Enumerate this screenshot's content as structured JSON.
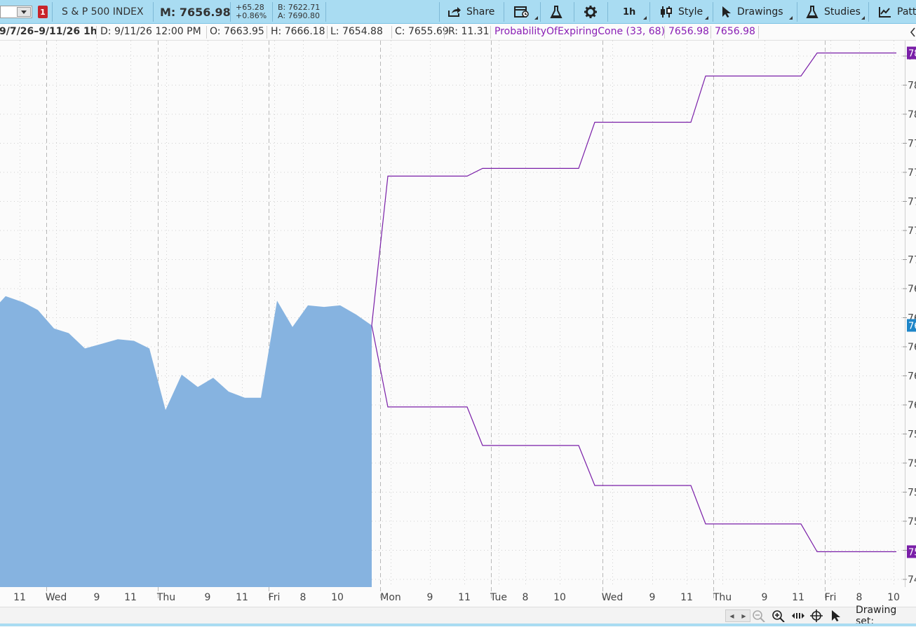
{
  "toolbar": {
    "link_number": "1",
    "symbol_name": "S & P 500 INDEX",
    "mark_price": "M: 7656.98",
    "net_change": "+65.28",
    "percent_change": "+0.86%",
    "bid": "B: 7622.71",
    "ask": "A: 7690.80",
    "share_label": "Share",
    "aggregation_label": "1h",
    "style_label": "Style",
    "drawings_label": "Drawings",
    "studies_label": "Studies",
    "patterns_label": "Patt"
  },
  "info_row": {
    "date_range": "9/7/26–9/11/26 1h",
    "date": "D: 9/11/26 12:00 PM",
    "open": "O: 7663.95",
    "high": "H: 7666.18",
    "low": "L: 7654.88",
    "close": "C: 7655.69",
    "range": "R: 11.31",
    "study_name": "ProbabilityOfExpiringCone (33, 68)",
    "study_value_1": "7656.98",
    "study_value_2": "7656.98"
  },
  "bottom_bar": {
    "drawing_set_label": "Drawing set:"
  },
  "colors": {
    "area_fill": "#86b3e0",
    "cone_line": "#7a1fa8",
    "toolbar_bg": "#a9dcf2",
    "price_tag": "#1f86c8",
    "cone_tag": "#7a1fa8"
  },
  "chart_data": {
    "type": "area",
    "title": "",
    "xlabel": "",
    "ylabel": "",
    "ylim": [
      7475,
      7830
    ],
    "grid": true,
    "x_tick_labels": [
      "11",
      "Wed",
      "9",
      "11",
      "Thu",
      "9",
      "11",
      "Fri",
      "8",
      "10",
      "Mon",
      "9",
      "11",
      "Tue",
      "8",
      "10",
      "Wed",
      "9",
      "11",
      "Thu",
      "9",
      "11",
      "Fri",
      "8",
      "10"
    ],
    "y_tick_labels": [
      "78",
      "78",
      "78",
      "77",
      "77",
      "77",
      "77",
      "77",
      "76",
      "76",
      "76",
      "76",
      "76",
      "75",
      "75",
      "75",
      "75",
      "75",
      "74"
    ],
    "price_tags": [
      "78",
      "76",
      "75"
    ],
    "series": [
      {
        "name": "S & P 500 INDEX",
        "style": "area",
        "values": [
          7664,
          7660,
          7655,
          7643,
          7640,
          7630,
          7633,
          7636,
          7635,
          7630,
          7590,
          7613,
          7605,
          7611,
          7602,
          7598,
          7598,
          7661,
          7644,
          7658,
          7657,
          7658,
          7652,
          7645
        ]
      },
      {
        "name": "ProbabilityOfExpiringCone (33, 68)",
        "style": "line",
        "upper": [
          7742,
          7742,
          7742,
          7747,
          7747,
          7747,
          7777,
          7777,
          7777,
          7807,
          7807,
          7807,
          7822,
          7822,
          7822
        ],
        "lower": [
          7592,
          7592,
          7592,
          7567,
          7567,
          7567,
          7541,
          7541,
          7541,
          7516,
          7516,
          7516,
          7498,
          7498,
          7498
        ]
      }
    ]
  }
}
